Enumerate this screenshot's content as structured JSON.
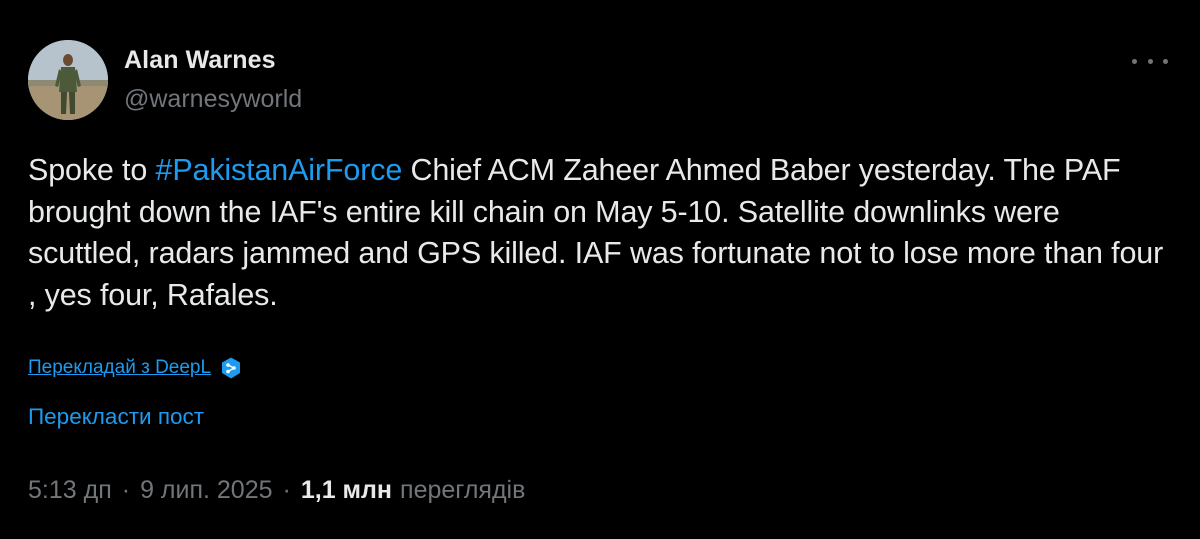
{
  "author": {
    "display_name": "Alan Warnes",
    "handle": "@warnesyworld"
  },
  "icons": {
    "more": "more-horizontal-icon",
    "deepl": "deepl-icon",
    "avatar": "avatar-photo"
  },
  "tweet": {
    "text_before_hashtag": "Spoke to ",
    "hashtag": "#PakistanAirForce",
    "text_after_hashtag": " Chief ACM Zaheer Ahmed Baber yesterday. The PAF brought down the IAF's entire kill chain on May 5-10. Satellite downlinks were scuttled, radars jammed and GPS killed.  IAF was fortunate not to lose more than four , yes four, Rafales."
  },
  "translation": {
    "deepl_label": "Перекладай з DeepL",
    "translate_post_label": "Перекласти пост"
  },
  "meta": {
    "time": "5:13 дп",
    "date": "9 лип. 2025",
    "separator": "·",
    "views_count": "1,1 млн",
    "views_label": "переглядів"
  },
  "colors": {
    "background": "#000000",
    "text": "#e7e9ea",
    "muted": "#71767b",
    "accent": "#1d9bf0"
  }
}
